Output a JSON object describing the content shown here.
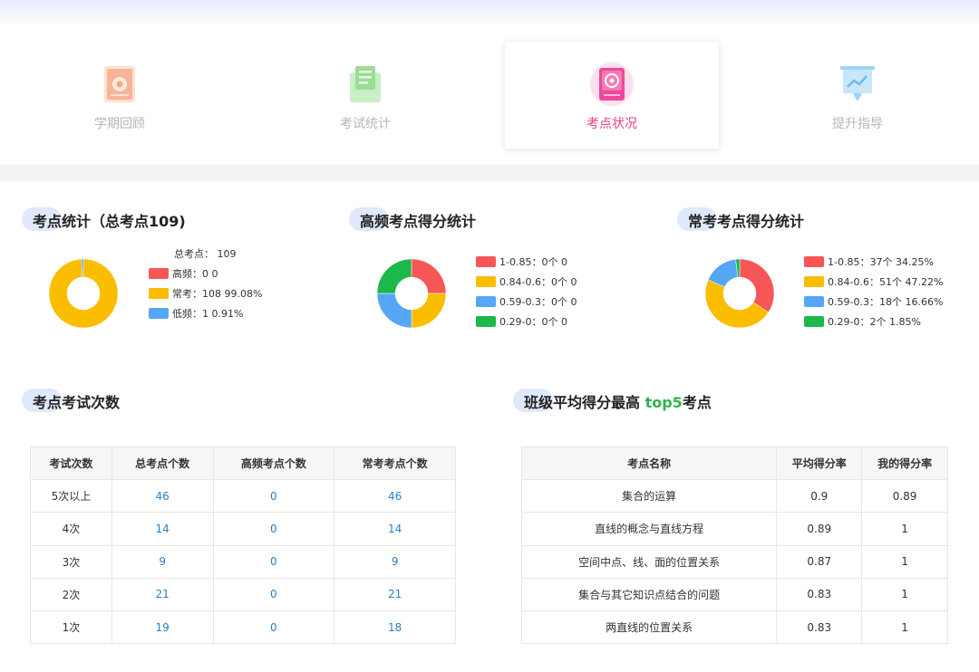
{
  "tabs": [
    {
      "label": "学期回顾",
      "icon": "semester-review-icon",
      "color": "#f7a57c",
      "active": false
    },
    {
      "label": "考试统计",
      "icon": "exam-stats-icon",
      "color": "#8fd48a",
      "active": false
    },
    {
      "label": "考点状况",
      "icon": "knowledge-point-target-icon",
      "color": "#ee3a8c",
      "active": true
    },
    {
      "label": "提升指导",
      "icon": "improvement-guide-icon",
      "color": "#7cc1f2",
      "active": false
    }
  ],
  "sections": {
    "stats": {
      "title": "考点统计（总考点109)"
    },
    "high": {
      "title": "高频考点得分统计"
    },
    "common": {
      "title": "常考考点得分统计"
    },
    "exam_count": {
      "title": "考点考试次数"
    },
    "top5": {
      "title_prefix": "班级平均得分最高 ",
      "title_highlight": "top5",
      "title_suffix": "考点"
    }
  },
  "colors": {
    "red": "#f75656",
    "yellow": "#fbbd00",
    "blue": "#56a6f6",
    "green": "#1db84a",
    "highlight": "#2fb34a",
    "link": "#2a7fc3"
  },
  "chart_data": [
    {
      "type": "pie",
      "name": "stats",
      "total_label": "总考点：  109",
      "series": [
        {
          "label": "高频：0   0",
          "value": 0,
          "color": "#f75656"
        },
        {
          "label": "常考：108   99.08%",
          "value": 108,
          "color": "#fbbd00"
        },
        {
          "label": "低频：1   0.91%",
          "value": 1,
          "color": "#56a6f6"
        }
      ]
    },
    {
      "type": "pie",
      "name": "high",
      "series": [
        {
          "label": "1-0.85：0个   0",
          "value": 0,
          "color": "#f75656"
        },
        {
          "label": "0.84-0.6：0个   0",
          "value": 0,
          "color": "#fbbd00"
        },
        {
          "label": "0.59-0.3：0个   0",
          "value": 0,
          "color": "#56a6f6"
        },
        {
          "label": "0.29-0：0个   0",
          "value": 0,
          "color": "#1db84a"
        }
      ]
    },
    {
      "type": "pie",
      "name": "common",
      "series": [
        {
          "label": "1-0.85：37个   34.25%",
          "value": 37,
          "color": "#f75656"
        },
        {
          "label": "0.84-0.6：51个   47.22%",
          "value": 51,
          "color": "#fbbd00"
        },
        {
          "label": "0.59-0.3：18个   16.66%",
          "value": 18,
          "color": "#56a6f6"
        },
        {
          "label": "0.29-0：2个   1.85%",
          "value": 2,
          "color": "#1db84a"
        }
      ]
    }
  ],
  "exam_table": {
    "headers": [
      "考试次数",
      "总考点个数",
      "高频考点个数",
      "常考考点个数"
    ],
    "rows": [
      [
        "5次以上",
        "46",
        "0",
        "46"
      ],
      [
        "4次",
        "14",
        "0",
        "14"
      ],
      [
        "3次",
        "9",
        "0",
        "9"
      ],
      [
        "2次",
        "21",
        "0",
        "21"
      ],
      [
        "1次",
        "19",
        "0",
        "18"
      ]
    ]
  },
  "top5_table": {
    "headers": [
      "考点名称",
      "平均得分率",
      "我的得分率"
    ],
    "rows": [
      [
        "集合的运算",
        "0.9",
        "0.89"
      ],
      [
        "直线的概念与直线方程",
        "0.89",
        "1"
      ],
      [
        "空间中点、线、面的位置关系",
        "0.87",
        "1"
      ],
      [
        "集合与其它知识点结合的问题",
        "0.83",
        "1"
      ],
      [
        "两直线的位置关系",
        "0.83",
        "1"
      ]
    ]
  }
}
